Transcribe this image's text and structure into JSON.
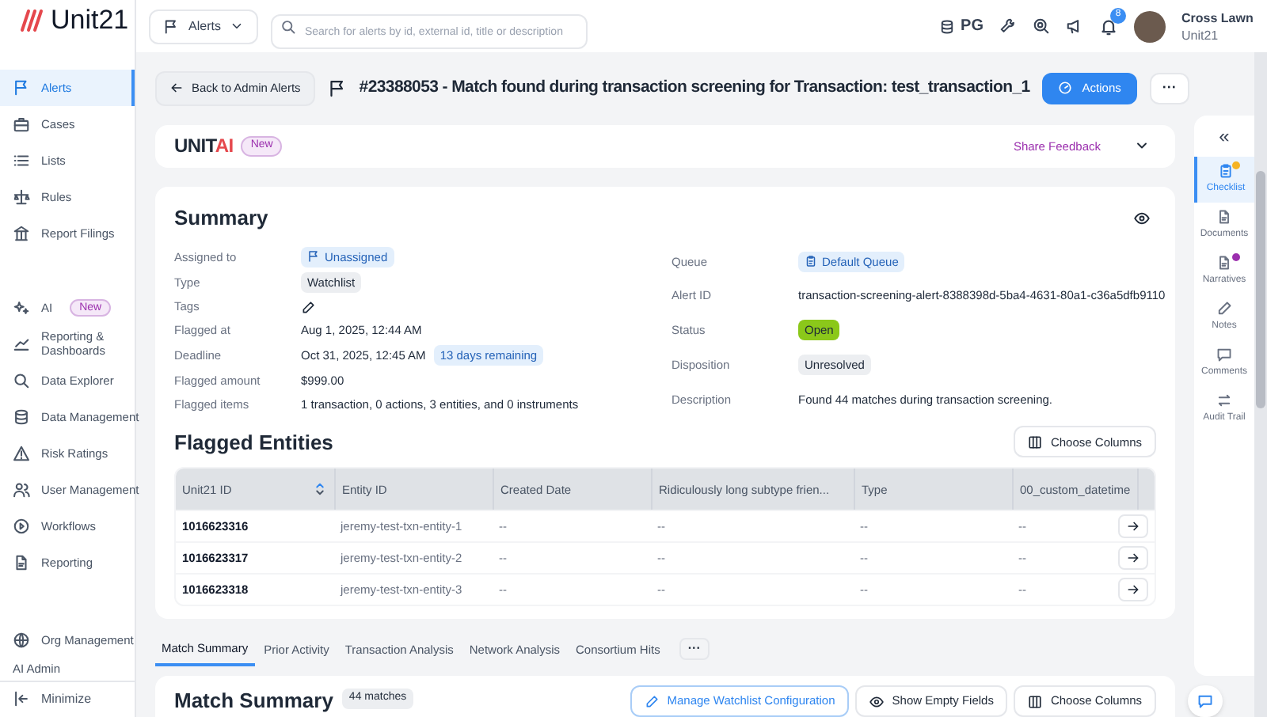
{
  "brand": {
    "name": "Unit21"
  },
  "header": {
    "scope_dropdown": "Alerts",
    "search_placeholder": "Search for alerts by id, external id, title or description",
    "org_code": "PG",
    "notification_count": "8",
    "user": {
      "name": "Cross Lawn",
      "org": "Unit21"
    }
  },
  "sidebar": {
    "groups": [
      [
        {
          "label": "Alerts",
          "selected": true
        },
        {
          "label": "Cases",
          "selected": false
        },
        {
          "label": "Lists",
          "selected": false
        },
        {
          "label": "Rules",
          "selected": false
        },
        {
          "label": "Report Filings",
          "selected": false
        }
      ],
      [
        {
          "label": "AI",
          "badge": "New",
          "selected": false
        },
        {
          "label": "Reporting & Dashboards",
          "selected": false
        },
        {
          "label": "Data Explorer",
          "selected": false
        },
        {
          "label": "Data Management",
          "selected": false
        },
        {
          "label": "Risk Ratings",
          "selected": false
        },
        {
          "label": "User Management",
          "selected": false
        },
        {
          "label": "Workflows",
          "selected": false
        },
        {
          "label": "Reporting",
          "selected": false
        }
      ],
      [
        {
          "label": "Org Management",
          "selected": false
        },
        {
          "label": "AI Admin",
          "selected": false
        }
      ]
    ],
    "minimize": "Minimize"
  },
  "page": {
    "back_button": "Back to Admin Alerts",
    "title": "#23388053 - Match found during transaction screening for Transaction: test_transaction_1",
    "actions_button": "Actions",
    "more_button": "···"
  },
  "unit_ai": {
    "logo_a": "UNIT",
    "logo_b": "AI",
    "badge": "New",
    "share_feedback": "Share Feedback",
    "expanded": false
  },
  "summary": {
    "title": "Summary",
    "left": [
      {
        "label": "Assigned to",
        "kind": "assignee",
        "value": "Unassigned"
      },
      {
        "label": "Type",
        "kind": "chip",
        "value": "Watchlist"
      },
      {
        "label": "Tags",
        "kind": "edit"
      },
      {
        "label": "Flagged at",
        "kind": "text",
        "value": "Aug 1, 2025, 12:44 AM"
      },
      {
        "label": "Deadline",
        "kind": "deadline",
        "value": "Oct 31, 2025, 12:45 AM",
        "note": "13 days remaining"
      },
      {
        "label": "Flagged amount",
        "kind": "text",
        "value": "$999.00"
      },
      {
        "label": "Flagged items",
        "kind": "text",
        "value": "1 transaction, 0 actions, 3 entities, and 0 instruments"
      }
    ],
    "right": [
      {
        "label": "Queue",
        "kind": "queue",
        "value": "Default Queue"
      },
      {
        "label": "Alert ID",
        "kind": "text",
        "value": "transaction-screening-alert-8388398d-5ba4-4631-80a1-c36a5dfb9110"
      },
      {
        "label": "Status",
        "kind": "status",
        "value": "Open"
      },
      {
        "label": "Disposition",
        "kind": "chip",
        "value": "Unresolved"
      },
      {
        "label": "Description",
        "kind": "text",
        "value": "Found 44 matches during transaction screening."
      }
    ]
  },
  "flagged_entities": {
    "title": "Flagged Entities",
    "choose_columns": "Choose Columns",
    "columns": [
      {
        "label": "Unit21 ID",
        "sorted": true
      },
      {
        "label": "Entity ID",
        "sorted": false
      },
      {
        "label": "Created Date",
        "sorted": false
      },
      {
        "label": "Ridiculously long subtype frien...",
        "sorted": false
      },
      {
        "label": "Type",
        "sorted": false
      },
      {
        "label": "00_custom_datetime",
        "sorted": false
      }
    ],
    "rows": [
      [
        "1016623316",
        "jeremy-test-txn-entity-1",
        "--",
        "--",
        "--",
        "--"
      ],
      [
        "1016623317",
        "jeremy-test-txn-entity-2",
        "--",
        "--",
        "--",
        "--"
      ],
      [
        "1016623318",
        "jeremy-test-txn-entity-3",
        "--",
        "--",
        "--",
        "--"
      ]
    ]
  },
  "tabs": [
    {
      "label": "Match Summary",
      "selected": true
    },
    {
      "label": "Prior Activity",
      "selected": false
    },
    {
      "label": "Transaction Analysis",
      "selected": false
    },
    {
      "label": "Network Analysis",
      "selected": false
    },
    {
      "label": "Consortium Hits",
      "selected": false
    }
  ],
  "tabs_more": "···",
  "match_summary": {
    "title": "Match Summary",
    "count": "44 matches",
    "buttons": [
      {
        "label": "Manage Watchlist Configuration",
        "kind": "primary"
      },
      {
        "label": "Show Empty Fields",
        "kind": "eye"
      },
      {
        "label": "Choose Columns",
        "kind": "columns"
      }
    ]
  },
  "right_rail": {
    "collapse": "«",
    "items": [
      {
        "label": "Checklist",
        "selected": true,
        "color": "#f5b324"
      },
      {
        "label": "Documents",
        "selected": false
      },
      {
        "label": "Narratives",
        "selected": false,
        "color": "#9b2fae"
      },
      {
        "label": "Notes",
        "selected": false
      },
      {
        "label": "Comments",
        "selected": false
      },
      {
        "label": "Audit Trail",
        "selected": false
      }
    ]
  }
}
